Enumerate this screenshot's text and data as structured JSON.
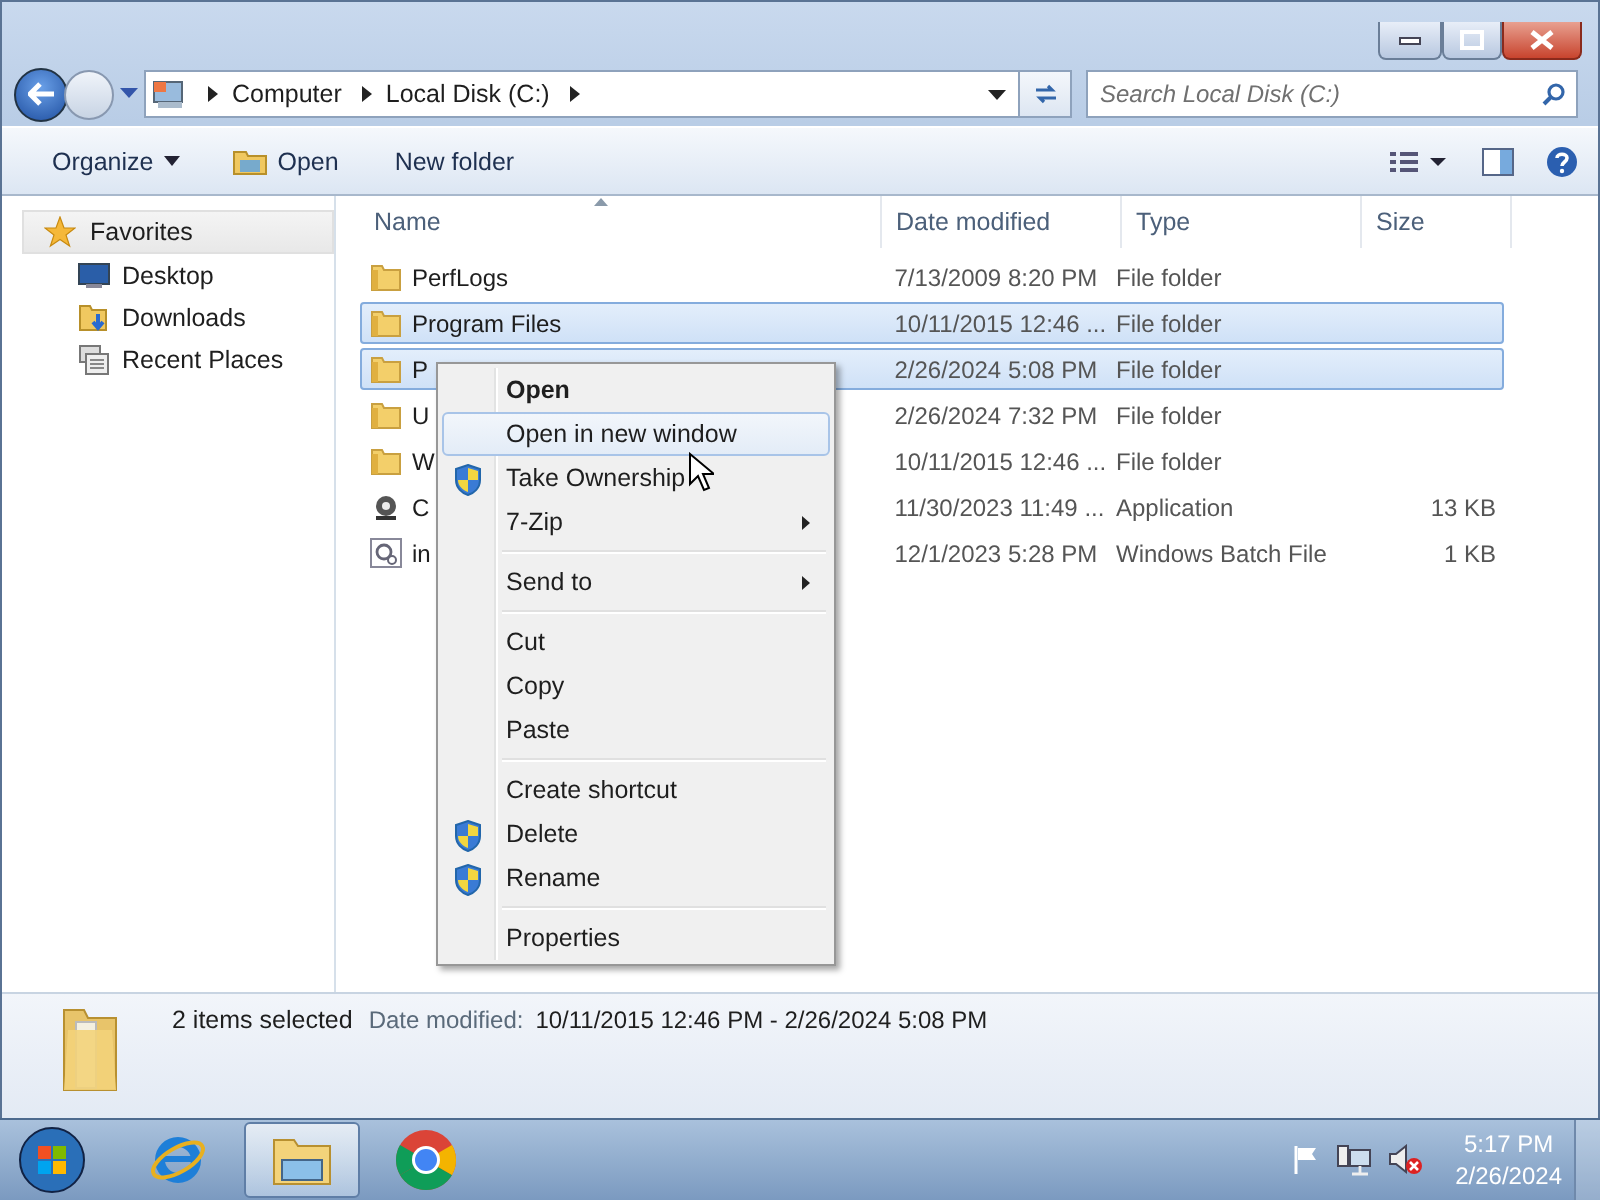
{
  "address_bar": {
    "crumbs": [
      "Computer",
      "Local Disk (C:)"
    ]
  },
  "search": {
    "placeholder": "Search Local Disk (C:)"
  },
  "toolbar": {
    "buttons": [
      {
        "label": "Organize",
        "kind": "dropdown"
      },
      {
        "label": "Open",
        "kind": "icon"
      },
      {
        "label": "New folder",
        "kind": "plain"
      }
    ]
  },
  "sidebar": {
    "header": "Favorites",
    "items": [
      {
        "label": "Desktop",
        "kind": "desktop"
      },
      {
        "label": "Downloads",
        "kind": "downloads"
      },
      {
        "label": "Recent Places",
        "kind": "recent"
      }
    ]
  },
  "table": {
    "columns": [
      {
        "label": "Name",
        "sorted": true
      },
      {
        "label": "Date modified",
        "sorted": false
      },
      {
        "label": "Type",
        "sorted": false
      },
      {
        "label": "Size",
        "sorted": false
      }
    ],
    "rows": [
      {
        "name": "PerfLogs",
        "date": "7/13/2009 8:20 PM",
        "type": "File folder",
        "size": "",
        "kind": "folder",
        "selected": false
      },
      {
        "name": "Program Files",
        "date": "10/11/2015 12:46 ...",
        "type": "File folder",
        "size": "",
        "kind": "folder",
        "selected": true
      },
      {
        "name": "P",
        "date": "2/26/2024 5:08 PM",
        "type": "File folder",
        "size": "",
        "kind": "folder",
        "selected": true
      },
      {
        "name": "U",
        "date": "2/26/2024 7:32 PM",
        "type": "File folder",
        "size": "",
        "kind": "folder",
        "selected": false
      },
      {
        "name": "W",
        "date": "10/11/2015 12:46 ...",
        "type": "File folder",
        "size": "",
        "kind": "folder",
        "selected": false
      },
      {
        "name": "C",
        "date": "11/30/2023 11:49 ...",
        "type": "Application",
        "size": "13 KB",
        "kind": "app",
        "selected": false
      },
      {
        "name": "in",
        "date": "12/1/2023 5:28 PM",
        "type": "Windows Batch File",
        "size": "1 KB",
        "kind": "batch",
        "selected": false
      }
    ]
  },
  "context_menu": {
    "groups": [
      [
        {
          "label": "Open",
          "bold": true,
          "shield": false,
          "submenu": false,
          "selected": false
        },
        {
          "label": "Open in new window",
          "bold": false,
          "shield": false,
          "submenu": false,
          "selected": true
        },
        {
          "label": "Take Ownership",
          "bold": false,
          "shield": true,
          "submenu": false,
          "selected": false
        },
        {
          "label": "7-Zip",
          "bold": false,
          "shield": false,
          "submenu": true,
          "selected": false
        }
      ],
      [
        {
          "label": "Send to",
          "bold": false,
          "shield": false,
          "submenu": true,
          "selected": false
        }
      ],
      [
        {
          "label": "Cut",
          "bold": false,
          "shield": false,
          "submenu": false,
          "selected": false
        },
        {
          "label": "Copy",
          "bold": false,
          "shield": false,
          "submenu": false,
          "selected": false
        },
        {
          "label": "Paste",
          "bold": false,
          "shield": false,
          "submenu": false,
          "selected": false
        }
      ],
      [
        {
          "label": "Create shortcut",
          "bold": false,
          "shield": false,
          "submenu": false,
          "selected": false
        },
        {
          "label": "Delete",
          "bold": false,
          "shield": true,
          "submenu": false,
          "selected": false
        },
        {
          "label": "Rename",
          "bold": false,
          "shield": true,
          "submenu": false,
          "selected": false
        }
      ],
      [
        {
          "label": "Properties",
          "bold": false,
          "shield": false,
          "submenu": false,
          "selected": false
        }
      ]
    ]
  },
  "details_pane": {
    "summary": "2 items selected",
    "label": "Date modified:",
    "value": "10/11/2015 12:46 PM - 2/26/2024 5:08 PM"
  },
  "taskbar": {
    "items": [
      {
        "kind": "start",
        "active": false
      },
      {
        "kind": "ie",
        "active": false
      },
      {
        "kind": "explorer",
        "active": true
      },
      {
        "kind": "chrome",
        "active": false
      }
    ],
    "tray": [
      {
        "kind": "flag"
      },
      {
        "kind": "network"
      },
      {
        "kind": "volume-muted"
      }
    ],
    "time": "5:17 PM",
    "date": "2/26/2024"
  }
}
